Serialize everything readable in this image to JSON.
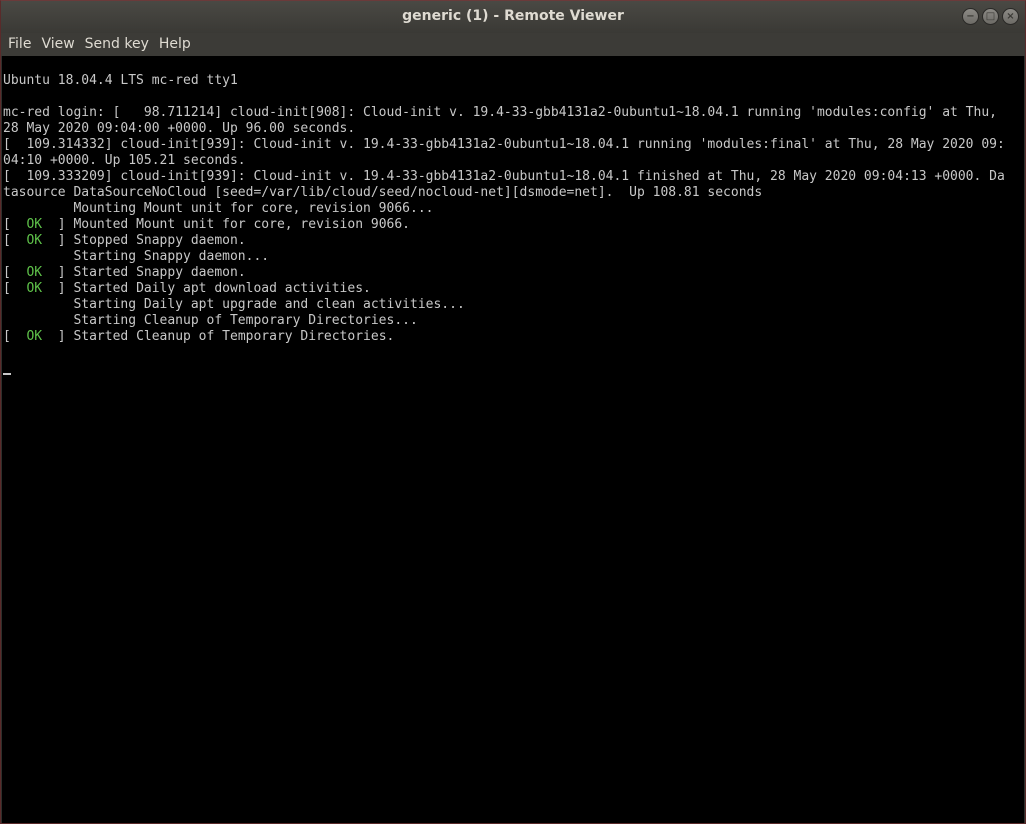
{
  "window": {
    "title": "generic (1) - Remote Viewer",
    "minimize_glyph": "−",
    "maximize_glyph": "□",
    "close_glyph": "×"
  },
  "menu": {
    "items": [
      "File",
      "View",
      "Send key",
      "Help"
    ]
  },
  "colors": {
    "ok_green": "#5fc24a",
    "console_text": "#c8c8c8",
    "console_bg": "#000000"
  },
  "console": {
    "lines": [
      {
        "text": "Ubuntu 18.04.4 LTS mc-red tty1"
      },
      {
        "text": ""
      },
      {
        "text": "mc-red login: [   98.711214] cloud-init[908]: Cloud-init v. 19.4-33-gbb4131a2-0ubuntu1~18.04.1 running 'modules:config' at Thu,"
      },
      {
        "text": "28 May 2020 09:04:00 +0000. Up 96.00 seconds."
      },
      {
        "text": "[  109.314332] cloud-init[939]: Cloud-init v. 19.4-33-gbb4131a2-0ubuntu1~18.04.1 running 'modules:final' at Thu, 28 May 2020 09:"
      },
      {
        "text": "04:10 +0000. Up 105.21 seconds."
      },
      {
        "text": "[  109.333209] cloud-init[939]: Cloud-init v. 19.4-33-gbb4131a2-0ubuntu1~18.04.1 finished at Thu, 28 May 2020 09:04:13 +0000. Da"
      },
      {
        "text": "tasource DataSourceNoCloud [seed=/var/lib/cloud/seed/nocloud-net][dsmode=net].  Up 108.81 seconds"
      },
      {
        "text": "         Mounting Mount unit for core, revision 9066..."
      },
      {
        "status": "OK",
        "text": "Mounted Mount unit for core, revision 9066."
      },
      {
        "status": "OK",
        "text": "Stopped Snappy daemon."
      },
      {
        "text": "         Starting Snappy daemon..."
      },
      {
        "status": "OK",
        "text": "Started Snappy daemon."
      },
      {
        "status": "OK",
        "text": "Started Daily apt download activities."
      },
      {
        "text": "         Starting Daily apt upgrade and clean activities..."
      },
      {
        "text": "         Starting Cleanup of Temporary Directories..."
      },
      {
        "status": "OK",
        "text": "Started Cleanup of Temporary Directories."
      },
      {
        "text": ""
      }
    ]
  }
}
